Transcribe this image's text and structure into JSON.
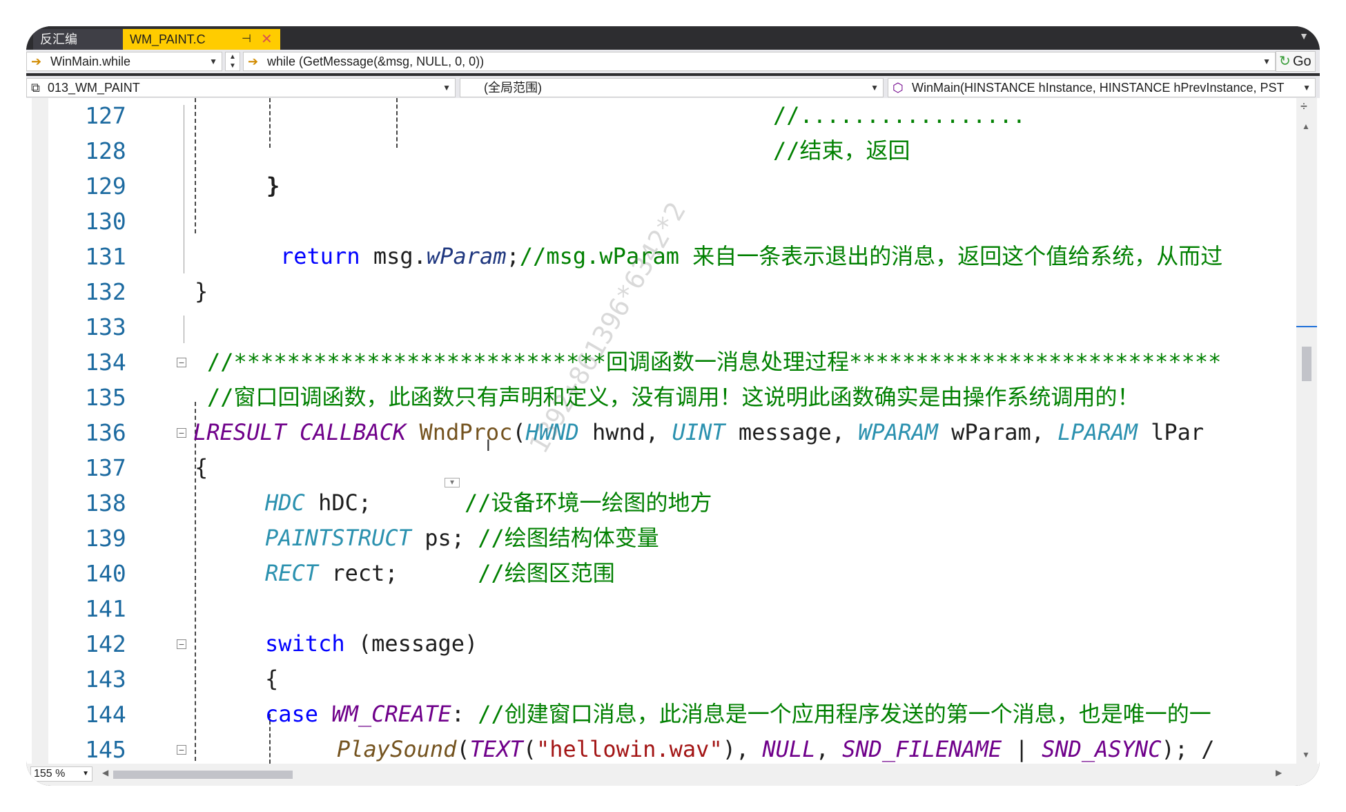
{
  "tabs": [
    {
      "label": "反汇编"
    },
    {
      "label": "WM_PAINT.C",
      "pin": "⊣",
      "close": "✕"
    }
  ],
  "nav": {
    "scope_combo": "WinMain.while",
    "statement_combo": "while (GetMessage(&msg, NULL, 0, 0))",
    "go_label": "Go",
    "project_combo": "013_WM_PAINT",
    "range_combo": "(全局范围)",
    "function_combo": "WinMain(HINSTANCE hInstance, HINSTANCE hPrevInstance, PST"
  },
  "code": {
    "l127": {
      "num": "127",
      "cm": "//................."
    },
    "l128": {
      "num": "128",
      "cm": "//结束，返回"
    },
    "l129": {
      "num": "129",
      "t": "}"
    },
    "l130": {
      "num": "130"
    },
    "l131": {
      "num": "131",
      "kw": "return",
      "a": " msg.",
      "f": "wParam",
      "b": ";",
      "cm": "//msg.wParam 来自一条表示退出的消息，返回这个值给系统，从而过"
    },
    "l132": {
      "num": "132",
      "t": "}"
    },
    "l133": {
      "num": "133"
    },
    "l134": {
      "num": "134",
      "cm": "//****************************回调函数一消息处理过程****************************"
    },
    "l135": {
      "num": "135",
      "cm": "//窗口回调函数，此函数只有声明和定义，没有调用！这说明此函数确实是由操作系统调用的！"
    },
    "l136": {
      "num": "136",
      "t1": "LRESULT",
      "t2": "CALLBACK",
      "fn": "WndProc",
      "p1": "(",
      "t3": "HWND",
      "p2": " hwnd, ",
      "t4": "UINT",
      "p3": " message, ",
      "t5": "WPARAM",
      "p4": " wParam, ",
      "t6": "LPARAM",
      "p5": " lPar"
    },
    "l137": {
      "num": "137",
      "t": "{"
    },
    "l138": {
      "num": "138",
      "ty": "HDC",
      "a": " hDC;       ",
      "cm": "//设备环境一绘图的地方"
    },
    "l139": {
      "num": "139",
      "ty": "PAINTSTRUCT",
      "a": " ps; ",
      "cm": "//绘图结构体变量"
    },
    "l140": {
      "num": "140",
      "ty": "RECT",
      "a": " rect;      ",
      "cm": "//绘图区范围"
    },
    "l141": {
      "num": "141"
    },
    "l142": {
      "num": "142",
      "kw": "switch",
      "a": " (message)"
    },
    "l143": {
      "num": "143",
      "t": "{"
    },
    "l144": {
      "num": "144",
      "kw": "case",
      "mac": " WM_CREATE",
      "a": ": ",
      "cm": "//创建窗口消息，此消息是一个应用程序发送的第一个消息，也是唯一的一"
    },
    "l145": {
      "num": "145",
      "fn": "PlaySound",
      "a": "(",
      "m1": "TEXT",
      "b": "(",
      "st": "\"hellowin.wav\"",
      "c": "), ",
      "m2": "NULL",
      "d": ", ",
      "m3": "SND_FILENAME",
      "e": " | ",
      "m4": "SND_ASYNC",
      "f": "); /"
    }
  },
  "watermark": "1392+861396*6342*2",
  "zoom": "155 %"
}
